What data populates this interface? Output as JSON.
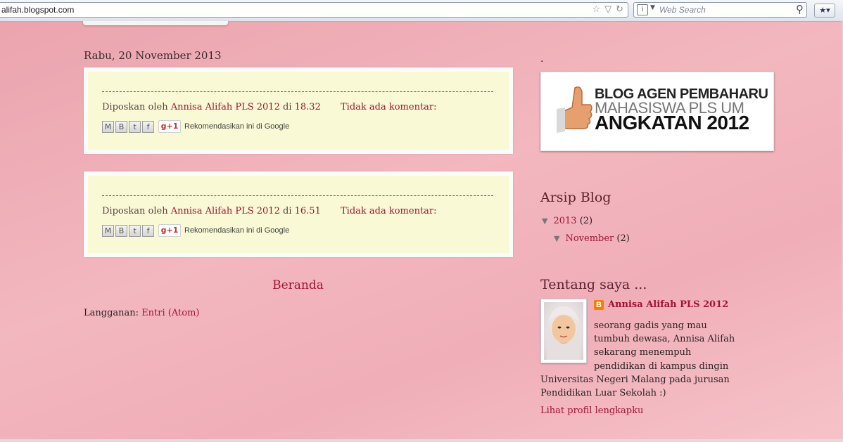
{
  "browser": {
    "url": "alifah.blogspot.com",
    "search_placeholder": "Web Search"
  },
  "main": {
    "date_header": "Rabu, 20 November 2013",
    "posts": [
      {
        "posted_by_label": "Diposkan oleh",
        "author": "Annisa Alifah PLS 2012",
        "at_label": "di",
        "time": "18.32",
        "comments": "Tidak ada komentar:",
        "share_icons": [
          "email-icon",
          "blogger-icon",
          "twitter-icon",
          "facebook-icon"
        ],
        "gplus_label": "g+1",
        "recommend_text": "Rekomendasikan ini di Google"
      },
      {
        "posted_by_label": "Diposkan oleh",
        "author": "Annisa Alifah PLS 2012",
        "at_label": "di",
        "time": "16.51",
        "comments": "Tidak ada komentar:",
        "share_icons": [
          "email-icon",
          "blogger-icon",
          "twitter-icon",
          "facebook-icon"
        ],
        "gplus_label": "g+1",
        "recommend_text": "Rekomendasikan ini di Google"
      }
    ],
    "home_link": "Beranda",
    "subscribe_label": "Langganan:",
    "subscribe_link": "Entri (Atom)"
  },
  "sidebar": {
    "dot_title": ".",
    "banner": {
      "line1": "BLOG AGEN PEMBAHARU",
      "line2": "MAHASISWA PLS UM",
      "line3": "ANGKATAN 2012"
    },
    "archive": {
      "title": "Arsip Blog",
      "year": "2013",
      "year_count": "(2)",
      "month": "November",
      "month_count": "(2)"
    },
    "about": {
      "title": "Tentang saya ...",
      "name": "Annisa Alifah PLS 2012",
      "lines": [
        "seorang gadis yang mau",
        "tumbuh dewasa, Annisa Alifah",
        "sekarang menempuh",
        "pendidikan di kampus dingin",
        "Universitas Negeri Malang pada jurusan",
        "Pendidikan Luar Sekolah :)"
      ],
      "profile_link": "Lihat profil lengkapku"
    }
  },
  "colors": {
    "link": "#a21333",
    "post_bg": "#f9f9d5",
    "page_bg": "#f0aeb8"
  }
}
